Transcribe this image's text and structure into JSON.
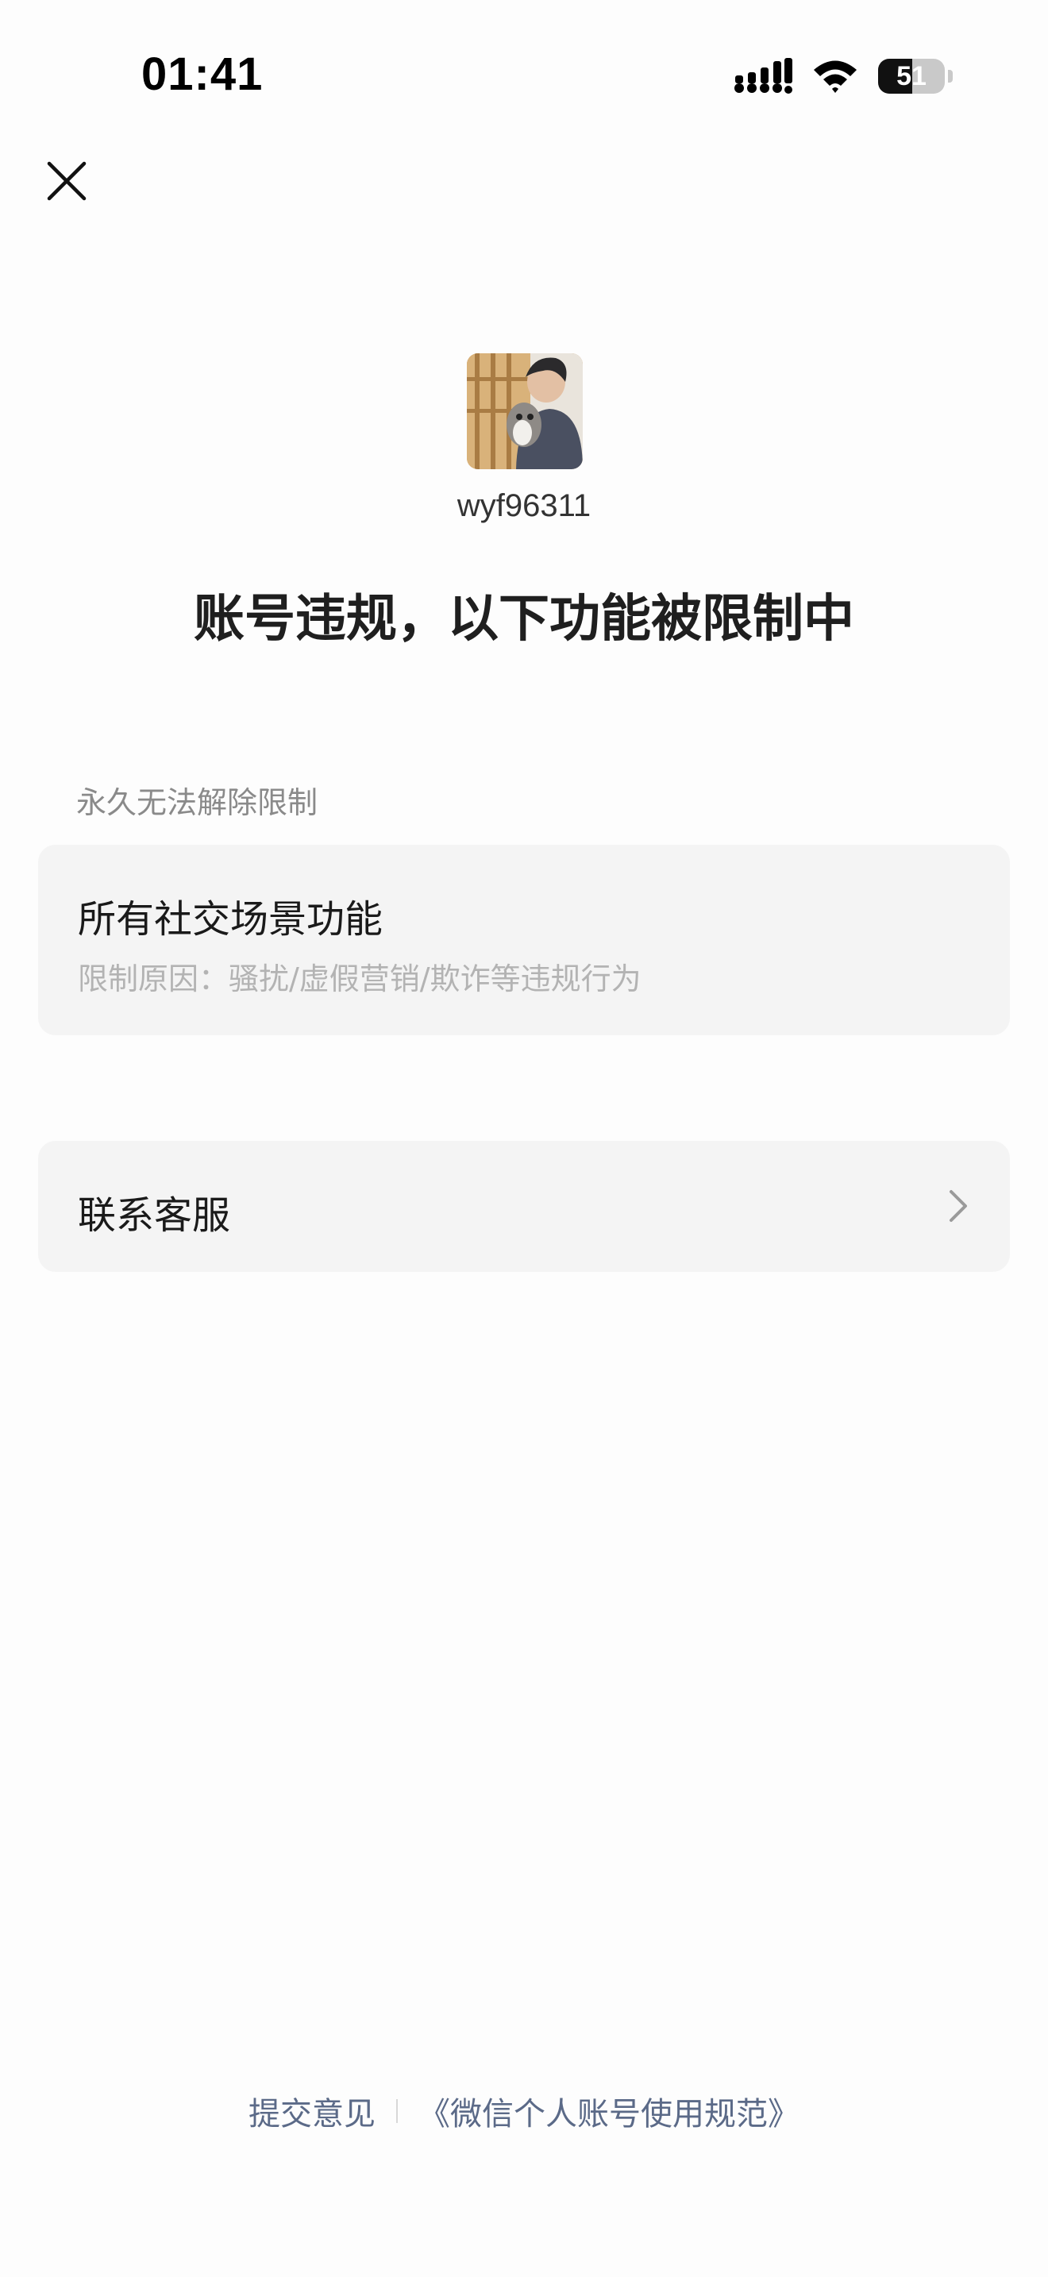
{
  "status_bar": {
    "time": "01:41",
    "battery_text": "51",
    "battery_level": 0.51,
    "icons": [
      "cellular-signal-icon",
      "wifi-icon",
      "battery-icon"
    ]
  },
  "nav": {
    "close_icon": "close-icon"
  },
  "account": {
    "username": "wyf96311",
    "avatar": "avatar-photo"
  },
  "headline": "账号违规，以下功能被限制中",
  "restriction": {
    "section_label": "永久无法解除限制",
    "title": "所有社交场景功能",
    "reason": "限制原因：骚扰/虚假营销/欺诈等违规行为"
  },
  "contact": {
    "label": "联系客服",
    "chevron_icon": "chevron-right-icon"
  },
  "footer": {
    "feedback": "提交意见",
    "policy_link": "《微信个人账号使用规范》"
  },
  "colors": {
    "background": "#fdfdfd",
    "card": "#f4f4f4",
    "link": "#5b6a88",
    "muted": "#8a8a8a"
  }
}
